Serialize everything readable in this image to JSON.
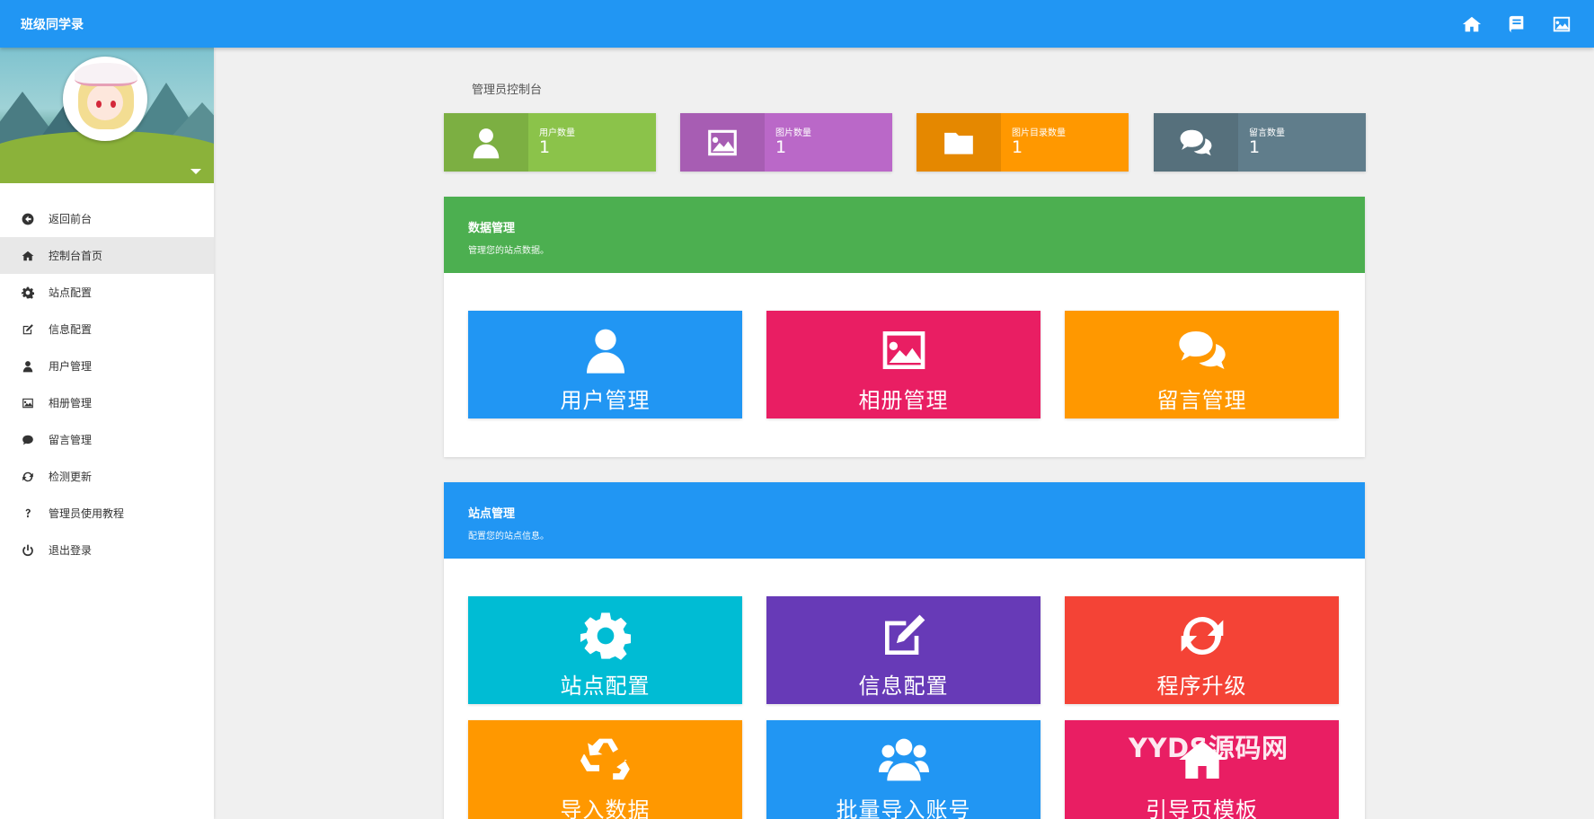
{
  "app": {
    "title": "班级同学录"
  },
  "topbar": {
    "actions": [
      {
        "icon": "home-icon"
      },
      {
        "icon": "book-icon"
      },
      {
        "icon": "image-icon"
      }
    ]
  },
  "sidebar": {
    "items": [
      {
        "label": "返回前台",
        "icon": "arrow-left-circle-icon",
        "active": false
      },
      {
        "label": "控制台首页",
        "icon": "home-icon",
        "active": true
      },
      {
        "label": "站点配置",
        "icon": "gear-icon",
        "active": false
      },
      {
        "label": "信息配置",
        "icon": "edit-icon",
        "active": false
      },
      {
        "label": "用户管理",
        "icon": "user-icon",
        "active": false
      },
      {
        "label": "相册管理",
        "icon": "image-icon",
        "active": false
      },
      {
        "label": "留言管理",
        "icon": "comment-icon",
        "active": false
      },
      {
        "label": "检测更新",
        "icon": "refresh-icon",
        "active": false
      },
      {
        "label": "管理员使用教程",
        "icon": "question-icon",
        "active": false
      },
      {
        "label": "退出登录",
        "icon": "power-icon",
        "active": false
      }
    ]
  },
  "main": {
    "breadcrumb": "管理员控制台",
    "stats": [
      {
        "label": "用户数量",
        "value": "1",
        "color": "#8bc34a",
        "icon": "user-icon"
      },
      {
        "label": "图片数量",
        "value": "1",
        "color": "#ba68c8",
        "icon": "image-icon"
      },
      {
        "label": "图片目录数量",
        "value": "1",
        "color": "#ff9800",
        "icon": "folder-icon"
      },
      {
        "label": "留言数量",
        "value": "1",
        "color": "#607d8b",
        "icon": "comments-icon"
      }
    ],
    "data_card": {
      "title": "数据管理",
      "subtitle": "管理您的站点数据。",
      "color": "#4caf50",
      "tiles": [
        {
          "label": "用户管理",
          "color": "#2196f3",
          "icon": "user-icon"
        },
        {
          "label": "相册管理",
          "color": "#e91e63",
          "icon": "image-icon"
        },
        {
          "label": "留言管理",
          "color": "#ff9800",
          "icon": "comments-icon"
        }
      ]
    },
    "site_card": {
      "title": "站点管理",
      "subtitle": "配置您的站点信息。",
      "color": "#2196f3",
      "tiles": [
        {
          "label": "站点配置",
          "color": "#00bcd4",
          "icon": "gear-icon"
        },
        {
          "label": "信息配置",
          "color": "#673ab7",
          "icon": "edit-icon"
        },
        {
          "label": "程序升级",
          "color": "#f44336",
          "icon": "refresh-icon"
        },
        {
          "label": "导入数据",
          "color": "#ff9800",
          "icon": "recycle-icon"
        },
        {
          "label": "批量导入账号",
          "color": "#2196f3",
          "icon": "users-icon"
        },
        {
          "label": "引导页模板",
          "color": "#e91e63",
          "icon": "home-icon"
        }
      ]
    },
    "watermark": "YYDS源码网"
  }
}
